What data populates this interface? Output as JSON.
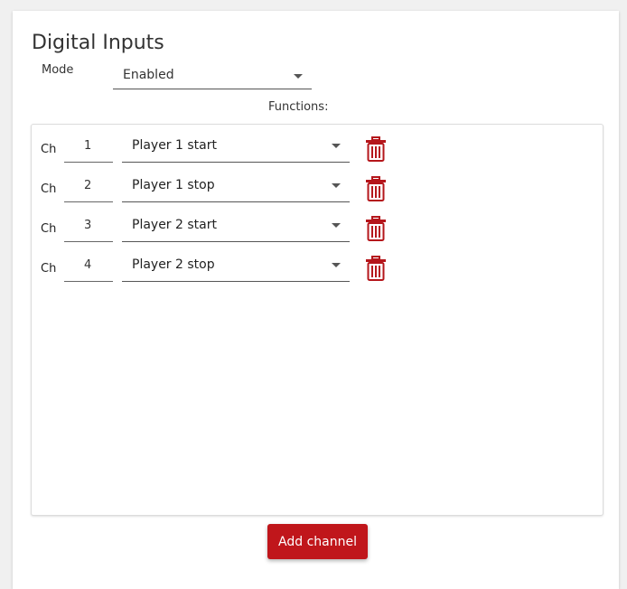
{
  "panel": {
    "title": "Digital Inputs",
    "mode_label": "Mode",
    "mode_value": "Enabled",
    "functions_label": "Functions:"
  },
  "channels": [
    {
      "ch_label": "Ch",
      "number": "1",
      "function": "Player 1 start"
    },
    {
      "ch_label": "Ch",
      "number": "2",
      "function": "Player 1 stop"
    },
    {
      "ch_label": "Ch",
      "number": "3",
      "function": "Player 2 start"
    },
    {
      "ch_label": "Ch",
      "number": "4",
      "function": "Player 2 stop"
    }
  ],
  "actions": {
    "add_channel_label": "Add channel"
  },
  "icons": {
    "delete": "trash-icon",
    "dropdown": "caret-down-icon"
  },
  "colors": {
    "accent": "#c0161b",
    "trash": "#b5161b"
  }
}
